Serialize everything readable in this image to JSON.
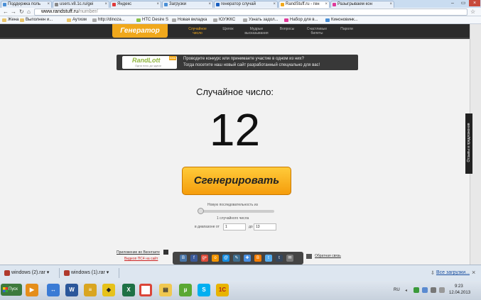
{
  "browser": {
    "tabs": [
      {
        "label": "Поддержка поль",
        "color": "#4a8fd6",
        "active": false
      },
      {
        "label": "users.v8.1c.ru/gei",
        "color": "#888888",
        "active": false
      },
      {
        "label": "Яндекс",
        "color": "#e03a3a",
        "active": false
      },
      {
        "label": "Загрузки",
        "color": "#4a8fd6",
        "active": false
      },
      {
        "label": "генератор случай",
        "color": "#1a5fc0",
        "active": false
      },
      {
        "label": "RandStuff.ru - ген",
        "color": "#f0a81c",
        "active": true
      },
      {
        "label": "Разыгрываем кон",
        "color": "#e03a9a",
        "active": false
      }
    ],
    "url_host": "www.randstuff.ru",
    "url_path": "/number/",
    "bookmarks": [
      "Жена",
      "Выполнен и...",
      "Аутизм",
      "http://dinoza...",
      "HTC Desire S",
      "Новая вкладка",
      "ЮУЖКС",
      "Узнать задол...",
      "Набор для в...",
      "Киноновинк..."
    ]
  },
  "site": {
    "logo": "Генератор",
    "nav": [
      {
        "label": "Случайное число",
        "active": true
      },
      {
        "label": "Щелок",
        "active": false
      },
      {
        "label": "Мудрые высказывания",
        "active": false
      },
      {
        "label": "Вопросы",
        "active": false
      },
      {
        "label": "Счастливые билеты",
        "active": false
      },
      {
        "label": "Пароли",
        "active": false
      }
    ]
  },
  "banner": {
    "logo_name": "RandLott",
    "logo_badge": "beta",
    "logo_sub": "Одна ночь до удачи",
    "line1": "Проводите конкурс или принимаете участие в одном из них?",
    "line2": "Тогда посетите наш новый сайт разработанный специально для вас!"
  },
  "main": {
    "label": "Случайное число:",
    "number": "12",
    "generate_button": "Сгенерировать",
    "new_sequence": "Новую последовательность из",
    "count_text": "1 случайного числа",
    "range_from_label": "в диапазоне от",
    "range_from": "1",
    "range_to_label": "до",
    "range_to": "13",
    "slider_fraction": 0
  },
  "footer": {
    "app_link": "Приложение во Вконтакте",
    "video_link": "Видеоп ПС4 на сайт",
    "feedback_link": "Обратная связь",
    "share_icons": [
      "vk-icon",
      "facebook-icon",
      "google-plus-icon",
      "odnoklassniki-icon",
      "mailru-icon",
      "livejournal-icon",
      "liveinternet-icon",
      "blogger-icon",
      "twitter-icon",
      "tumblr-icon",
      "email-icon"
    ]
  },
  "feedback_tab": "Отзывы и предложения",
  "downloads": {
    "items": [
      "windows (2).rar",
      "windows (1).rar"
    ],
    "show_all": "Все загрузки...",
    "close": "×"
  },
  "taskbar": {
    "start": "Пуск",
    "lang": "RU",
    "time": "9:23",
    "date": "12.04.2013"
  }
}
